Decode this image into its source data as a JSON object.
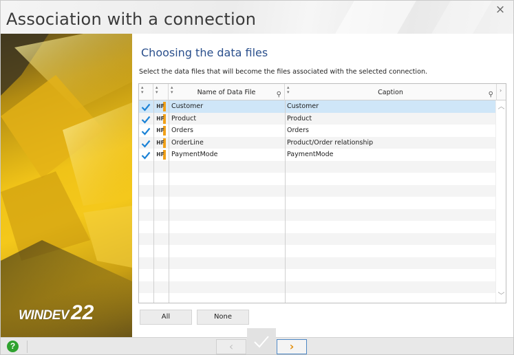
{
  "window": {
    "title": "Association with a connection",
    "close_icon": "×"
  },
  "sidebar": {
    "logo_text": "WINDEV",
    "logo_version": "22"
  },
  "main": {
    "heading": "Choosing the data files",
    "instruction": "Select the data files that will become the files associated with the selected connection."
  },
  "table": {
    "columns": {
      "name": "Name of Data File",
      "caption": "Caption"
    },
    "badge_label": "HF",
    "rows": [
      {
        "name": "Customer",
        "caption": "Customer",
        "checked": true
      },
      {
        "name": "Product",
        "caption": "Product",
        "checked": true
      },
      {
        "name": "Orders",
        "caption": "Orders",
        "checked": true
      },
      {
        "name": "OrderLine",
        "caption": "Product/Order relationship",
        "checked": true
      },
      {
        "name": "PaymentMode",
        "caption": "PaymentMode",
        "checked": true
      }
    ]
  },
  "buttons": {
    "all": "All",
    "none": "None"
  },
  "footer": {
    "help_label": "?",
    "prev_icon": "‹",
    "next_icon": "›"
  },
  "colors": {
    "accent": "#2a4f8c",
    "selection": "#cfe6f8",
    "check": "#1a82d6",
    "badge": "#f0a018",
    "next_arrow": "#e38f0c"
  }
}
